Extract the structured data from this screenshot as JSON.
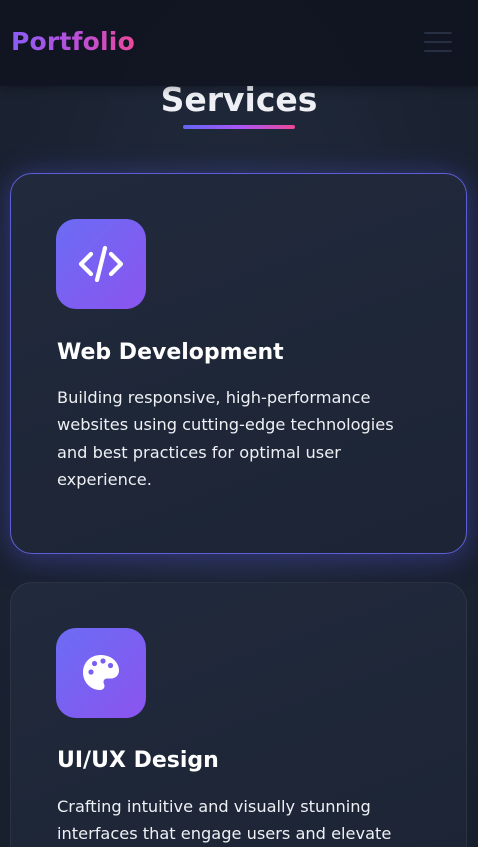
{
  "navbar": {
    "logo": "Portfolio",
    "menu_icon": "hamburger-menu-icon"
  },
  "section": {
    "title": "Services"
  },
  "services": [
    {
      "icon": "code-icon",
      "title": "Web Development",
      "description": "Building responsive, high-performance websites using cutting-edge technologies and best practices for optimal user experience."
    },
    {
      "icon": "palette-icon",
      "title": "UI/UX Design",
      "description": "Crafting intuitive and visually stunning interfaces that engage users and elevate"
    }
  ],
  "colors": {
    "accent_start": "#6366f1",
    "accent_mid": "#a855f7",
    "accent_end": "#ec4899",
    "background": "#1a2231",
    "card": "#1f2738"
  }
}
